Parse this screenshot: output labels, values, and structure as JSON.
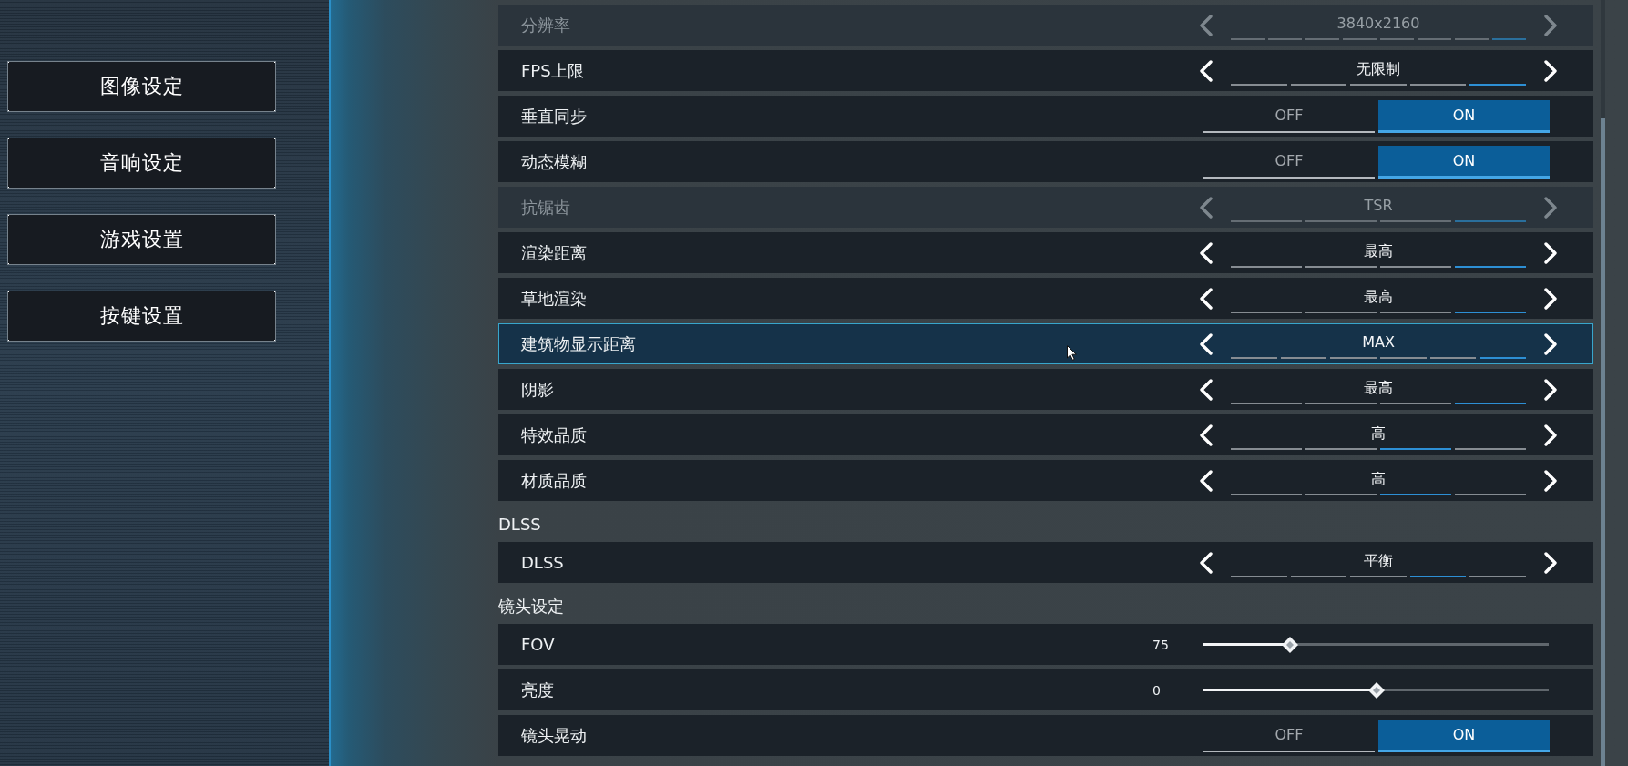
{
  "sidebar": {
    "items": [
      {
        "label": "图像设定"
      },
      {
        "label": "音响设定"
      },
      {
        "label": "游戏设置"
      },
      {
        "label": "按键设置"
      }
    ]
  },
  "groups": [
    {
      "rows": [
        {
          "kind": "selector",
          "label": "分辨率",
          "disabled": true,
          "focused": false,
          "value": "3840x2160",
          "segments": [
            {
              "selected": false
            },
            {
              "selected": false
            },
            {
              "selected": false
            },
            {
              "selected": false
            },
            {
              "selected": false
            },
            {
              "selected": false
            },
            {
              "selected": false
            },
            {
              "selected": true
            }
          ]
        },
        {
          "kind": "selector",
          "label": "FPS上限",
          "disabled": false,
          "focused": false,
          "value": "无限制",
          "segments": [
            {
              "selected": false
            },
            {
              "selected": false
            },
            {
              "selected": false
            },
            {
              "selected": false
            },
            {
              "selected": true
            }
          ]
        },
        {
          "kind": "toggle",
          "label": "垂直同步",
          "disabled": false,
          "focused": false,
          "options": [
            {
              "label": "OFF",
              "selected": false
            },
            {
              "label": "ON",
              "selected": true
            }
          ]
        },
        {
          "kind": "toggle",
          "label": "动态模糊",
          "disabled": false,
          "focused": false,
          "options": [
            {
              "label": "OFF",
              "selected": false
            },
            {
              "label": "ON",
              "selected": true
            }
          ]
        },
        {
          "kind": "selector",
          "label": "抗锯齿",
          "disabled": true,
          "focused": false,
          "value": "TSR",
          "segments": [
            {
              "selected": false
            },
            {
              "selected": false
            },
            {
              "selected": false
            },
            {
              "selected": true
            }
          ]
        },
        {
          "kind": "selector",
          "label": "渲染距离",
          "disabled": false,
          "focused": false,
          "value": "最高",
          "segments": [
            {
              "selected": false
            },
            {
              "selected": false
            },
            {
              "selected": false
            },
            {
              "selected": true
            }
          ]
        },
        {
          "kind": "selector",
          "label": "草地渲染",
          "disabled": false,
          "focused": false,
          "value": "最高",
          "segments": [
            {
              "selected": false
            },
            {
              "selected": false
            },
            {
              "selected": false
            },
            {
              "selected": true
            }
          ]
        },
        {
          "kind": "selector",
          "label": "建筑物显示距离",
          "disabled": false,
          "focused": true,
          "value": "MAX",
          "segments": [
            {
              "selected": false
            },
            {
              "selected": false
            },
            {
              "selected": false
            },
            {
              "selected": false
            },
            {
              "selected": false
            },
            {
              "selected": true
            }
          ]
        },
        {
          "kind": "selector",
          "label": "阴影",
          "disabled": false,
          "focused": false,
          "value": "最高",
          "segments": [
            {
              "selected": false
            },
            {
              "selected": false
            },
            {
              "selected": false
            },
            {
              "selected": true
            }
          ]
        },
        {
          "kind": "selector",
          "label": "特效品质",
          "disabled": false,
          "focused": false,
          "value": "高",
          "segments": [
            {
              "selected": false
            },
            {
              "selected": false
            },
            {
              "selected": true
            },
            {
              "selected": false
            }
          ]
        },
        {
          "kind": "selector",
          "label": "材质品质",
          "disabled": false,
          "focused": false,
          "value": "高",
          "segments": [
            {
              "selected": false
            },
            {
              "selected": false
            },
            {
              "selected": true
            },
            {
              "selected": false
            }
          ]
        }
      ]
    },
    {
      "title": "DLSS",
      "rows": [
        {
          "kind": "selector",
          "label": "DLSS",
          "disabled": false,
          "focused": false,
          "value": "平衡",
          "segments": [
            {
              "selected": false
            },
            {
              "selected": false
            },
            {
              "selected": false
            },
            {
              "selected": true
            },
            {
              "selected": false
            }
          ]
        }
      ]
    },
    {
      "title": "镜头设定",
      "rows": [
        {
          "kind": "slider",
          "label": "FOV",
          "disabled": false,
          "focused": false,
          "reading": "75",
          "level": 0.25
        },
        {
          "kind": "slider",
          "label": "亮度",
          "disabled": false,
          "focused": false,
          "reading": "0",
          "level": 0.5
        },
        {
          "kind": "toggle",
          "label": "镜头晃动",
          "disabled": false,
          "focused": false,
          "options": [
            {
              "label": "OFF",
              "selected": false
            },
            {
              "label": "ON",
              "selected": true
            }
          ]
        }
      ]
    }
  ]
}
